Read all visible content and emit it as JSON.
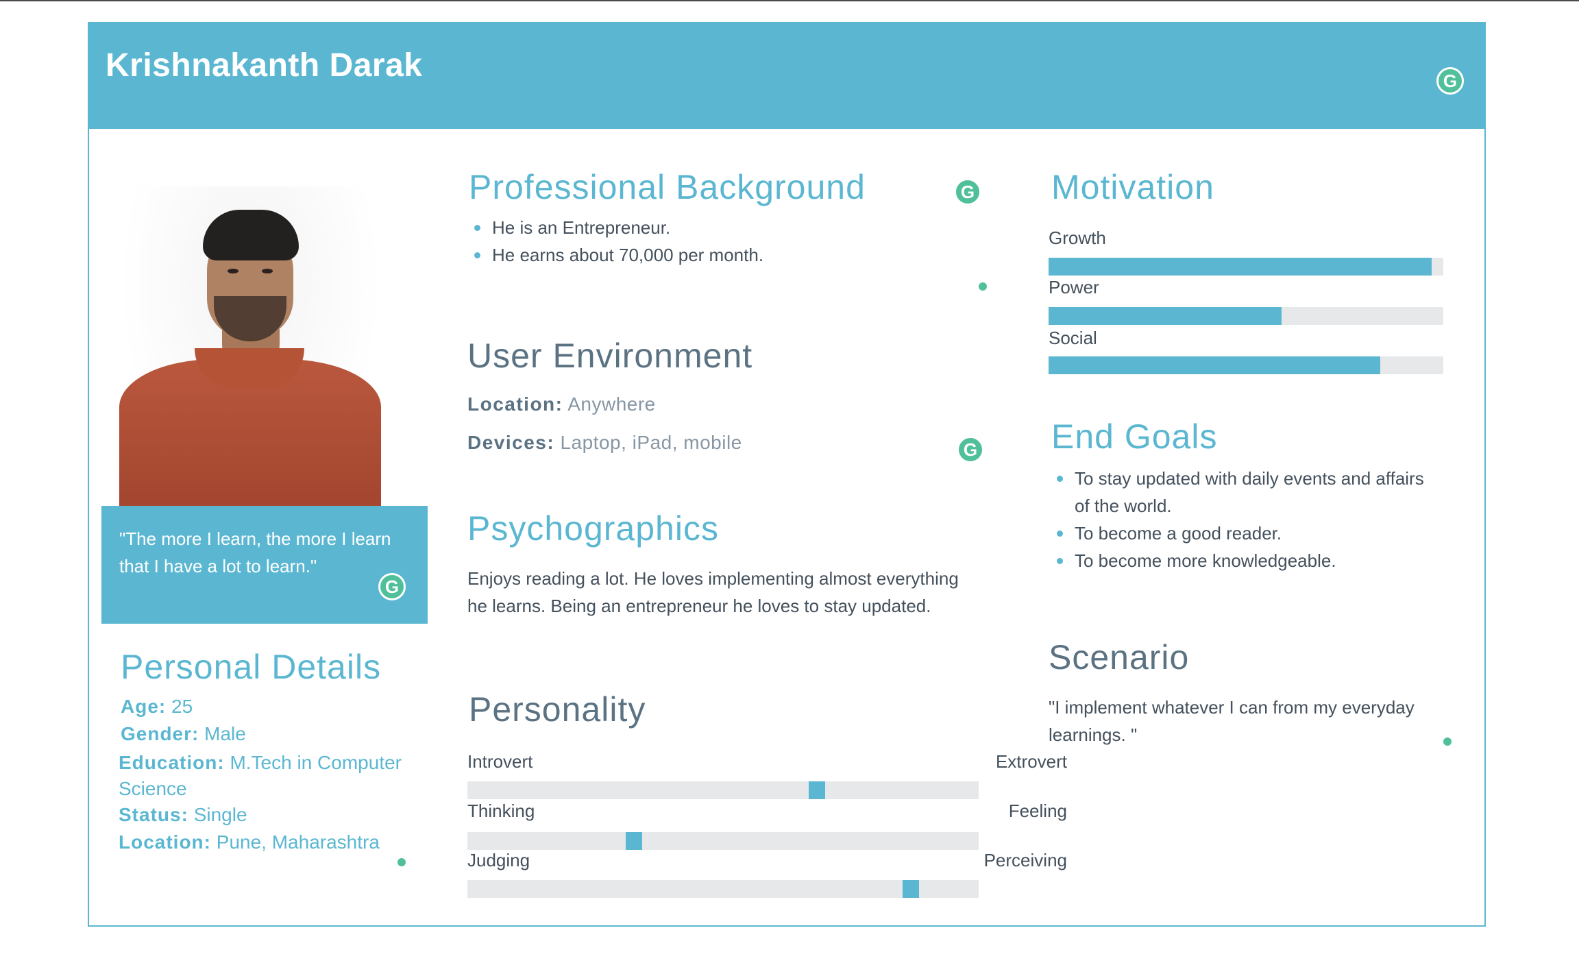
{
  "persona": {
    "name": "Krishnakanth Darak",
    "quote": "\"The more I learn, the more I learn that I have a lot to learn.\""
  },
  "personal_details": {
    "title": "Personal Details",
    "age_label": "Age:",
    "age": "25",
    "gender_label": "Gender:",
    "gender": "Male",
    "education_label": "Education:",
    "education_line1": "M.Tech in Computer",
    "education_line2": "Science",
    "status_label": "Status:",
    "status": "Single",
    "location_label": "Location:",
    "location": "Pune, Maharashtra"
  },
  "professional_background": {
    "title": "Professional Background",
    "items": [
      "He is an Entrepreneur.",
      "He earns about 70,000 per month."
    ]
  },
  "user_environment": {
    "title": "User Environment",
    "location_label": "Location:",
    "location": "Anywhere",
    "devices_label": "Devices:",
    "devices": "Laptop, iPad, mobile"
  },
  "psychographics": {
    "title": "Psychographics",
    "line1": "Enjoys reading a lot. He loves implementing almost everything",
    "line2": "he learns. Being an entrepreneur he loves to stay updated."
  },
  "personality": {
    "title": "Personality",
    "traits": [
      {
        "left": "Introvert",
        "right": "Extrovert",
        "value": 0.69
      },
      {
        "left": "Thinking",
        "right": "Feeling",
        "value": 0.32
      },
      {
        "left": "Judging",
        "right": "Perceiving",
        "value": 0.88
      }
    ]
  },
  "motivation": {
    "title": "Motivation",
    "items": [
      {
        "label": "Growth",
        "value": 0.97
      },
      {
        "label": "Power",
        "value": 0.59
      },
      {
        "label": "Social",
        "value": 0.84
      }
    ]
  },
  "end_goals": {
    "title": "End Goals",
    "items": [
      {
        "line1": "To stay updated with daily events and affairs",
        "line2": "of the world."
      },
      {
        "line1": "To become a good reader.",
        "line2": ""
      },
      {
        "line1": "To become more knowledgeable.",
        "line2": ""
      }
    ]
  },
  "scenario": {
    "title": "Scenario",
    "line1": "\"I implement whatever I can from my everyday",
    "line2": "learnings. \""
  },
  "icons": {
    "grammarly": "grammarly-icon",
    "glyph": "G"
  },
  "colors": {
    "accent": "#5bb7d1",
    "icon_green": "#4fc09a",
    "track": "#e7e8ea"
  }
}
